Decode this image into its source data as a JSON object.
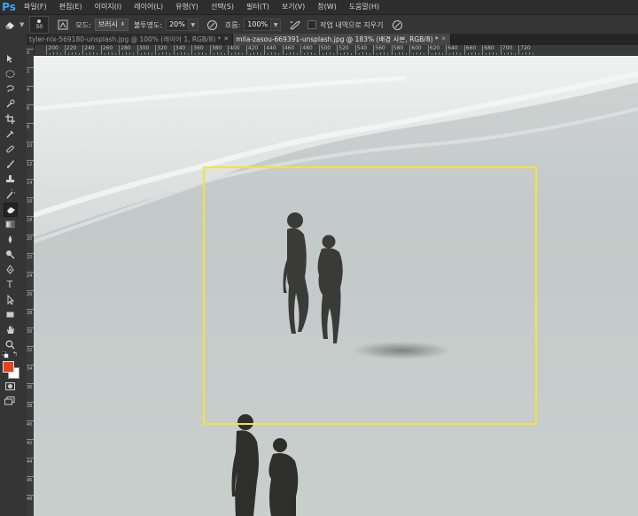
{
  "app": {
    "logo": "Ps"
  },
  "menu": [
    "파일(F)",
    "편집(E)",
    "이미지(I)",
    "레이어(L)",
    "유형(Y)",
    "선택(S)",
    "필터(T)",
    "보기(V)",
    "창(W)",
    "도움말(H)"
  ],
  "options": {
    "brush_size": "50",
    "mode_label": "모드:",
    "mode_value": "브러시",
    "opacity_label": "불투명도:",
    "opacity_value": "20%",
    "flow_label": "흐름:",
    "flow_value": "100%",
    "erase_history_label": "작업 내역으로 지우기"
  },
  "tabs": [
    {
      "title": "tyler-nix-569180-unsplash.jpg @ 100% (레이어 1, RGB/8) *",
      "active": false
    },
    {
      "title": "mila-zasou-669391-unsplash.jpg @ 183% (배경 사본, RGB/8) *",
      "active": true
    }
  ],
  "ruler": {
    "top_labels": [
      "200",
      "220",
      "240",
      "260",
      "280",
      "300",
      "320",
      "340",
      "360",
      "380",
      "400",
      "420",
      "440",
      "460",
      "480",
      "500",
      "520",
      "540",
      "560",
      "580",
      "600",
      "620",
      "640",
      "660",
      "680",
      "700",
      "720"
    ],
    "left_labels": [
      "0",
      "2",
      "4",
      "6",
      "8",
      "10",
      "12",
      "14",
      "16",
      "18",
      "20",
      "22",
      "24",
      "26",
      "28",
      "30",
      "32",
      "34",
      "36",
      "38",
      "40",
      "42",
      "44",
      "46",
      "48",
      "50"
    ]
  },
  "colors": {
    "foreground": "#e8421d",
    "background": "#ffffff",
    "selection_box": "#f5e33a"
  },
  "tools": [
    "move-icon",
    "marquee-icon",
    "lasso-icon",
    "quick-select-icon",
    "crop-icon",
    "eyedropper-icon",
    "healing-brush-icon",
    "brush-icon",
    "clone-stamp-icon",
    "history-brush-icon",
    "eraser-icon",
    "gradient-icon",
    "blur-icon",
    "dodge-icon",
    "pen-icon",
    "type-icon",
    "path-select-icon",
    "rectangle-icon",
    "hand-icon",
    "zoom-icon"
  ]
}
